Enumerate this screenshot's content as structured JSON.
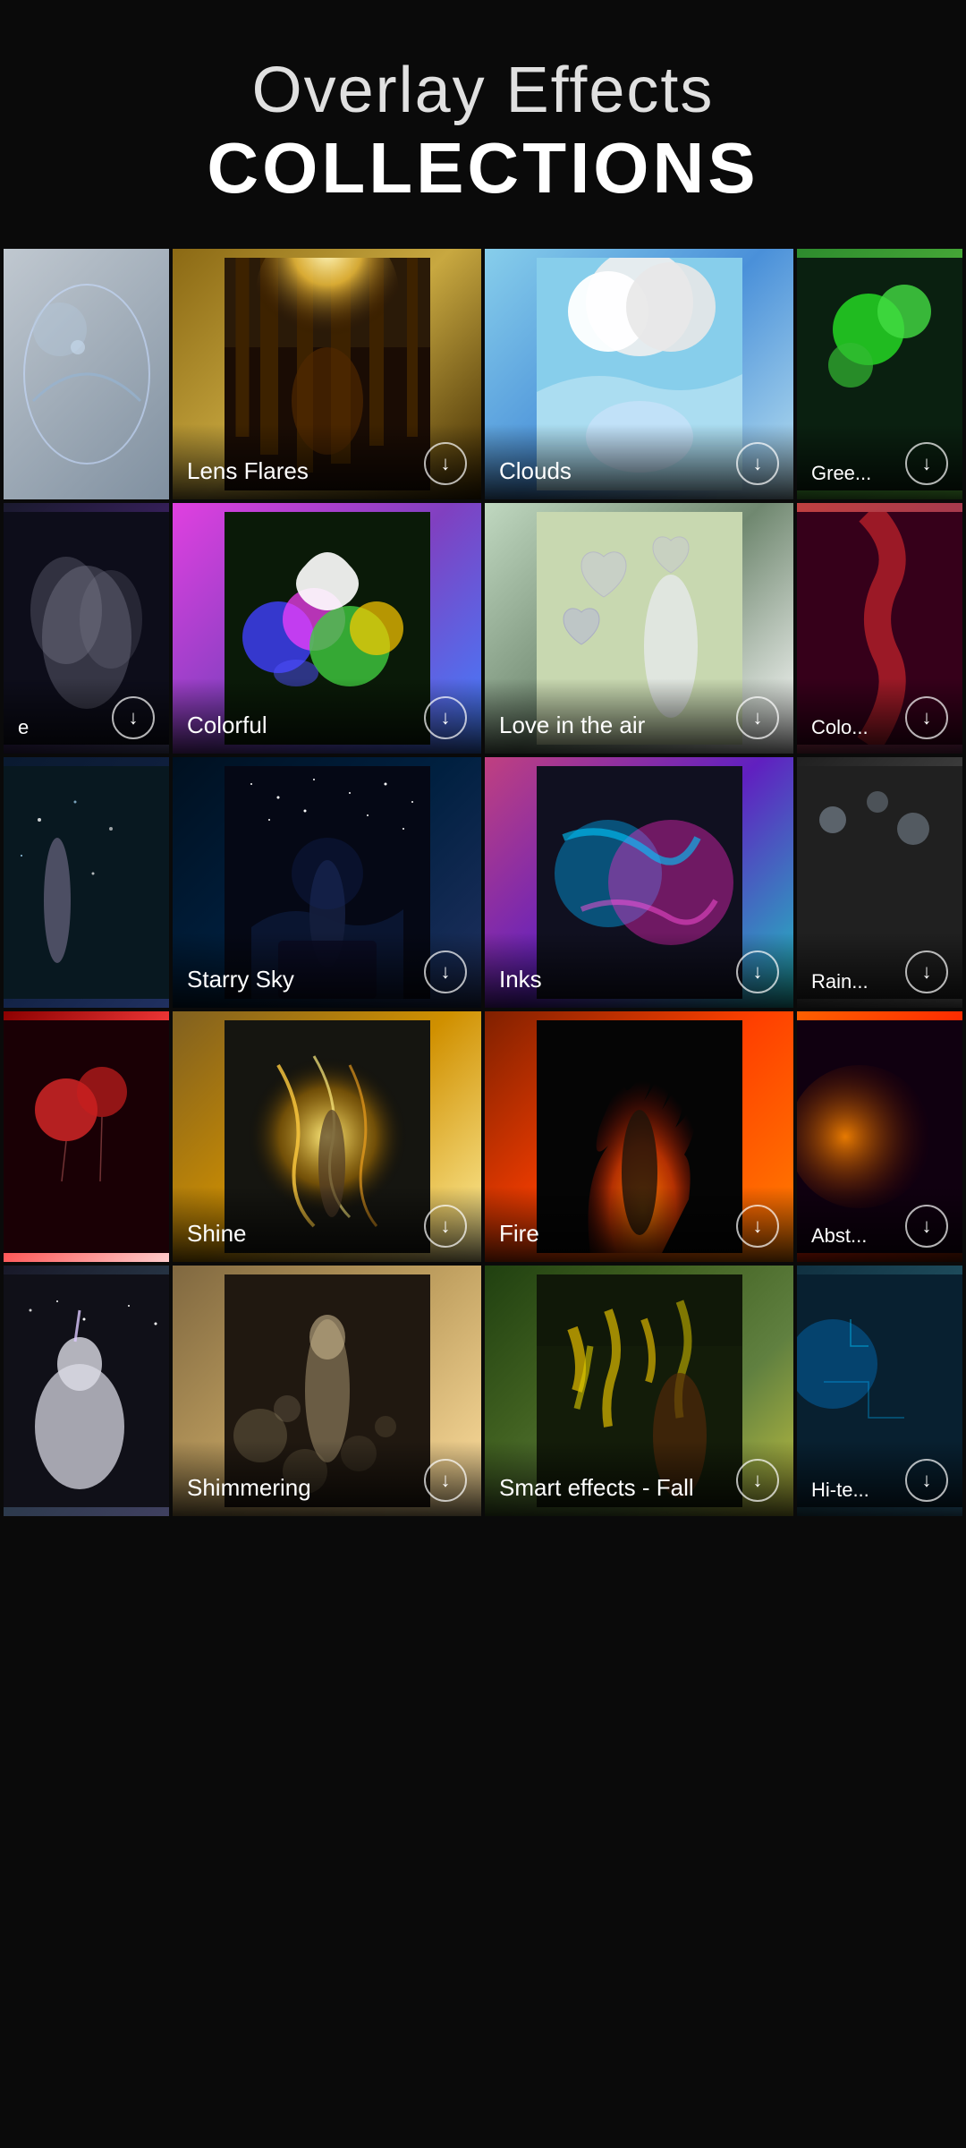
{
  "header": {
    "title_line1": "Overlay Effects",
    "title_line2": "COLLECTIONS"
  },
  "grid": {
    "rows": [
      {
        "id": "row1",
        "cards": [
          {
            "id": "card-water-horse",
            "label": "",
            "bg": "card-bg-1",
            "partial": true
          },
          {
            "id": "card-lens-flares",
            "label": "Lens Flares",
            "bg": "card-bg-2",
            "partial": false
          },
          {
            "id": "card-clouds",
            "label": "Clouds",
            "bg": "card-bg-3",
            "partial": false
          },
          {
            "id": "card-green",
            "label": "Gree...",
            "bg": "card-bg-4",
            "partial": true
          }
        ]
      },
      {
        "id": "row2",
        "cards": [
          {
            "id": "card-smoke",
            "label": "e",
            "bg": "card-bg-5",
            "partial": true
          },
          {
            "id": "card-colorful",
            "label": "Colorful",
            "bg": "card-bg-6",
            "partial": false
          },
          {
            "id": "card-love-air",
            "label": "Love in the air",
            "bg": "card-bg-7",
            "partial": false
          },
          {
            "id": "card-color2",
            "label": "Colo...",
            "bg": "card-bg-8",
            "partial": true
          }
        ]
      },
      {
        "id": "row3",
        "cards": [
          {
            "id": "card-fairy",
            "label": "",
            "bg": "card-bg-9",
            "partial": true
          },
          {
            "id": "card-starry-sky",
            "label": "Starry Sky",
            "bg": "card-bg-10",
            "partial": false
          },
          {
            "id": "card-inks",
            "label": "Inks",
            "bg": "card-bg-11",
            "partial": false
          },
          {
            "id": "card-rain",
            "label": "Rain...",
            "bg": "card-bg-12",
            "partial": true
          }
        ]
      },
      {
        "id": "row4",
        "cards": [
          {
            "id": "card-balloons",
            "label": "",
            "bg": "card-bg-13",
            "partial": true
          },
          {
            "id": "card-shine",
            "label": "Shine",
            "bg": "card-bg-14",
            "partial": false
          },
          {
            "id": "card-fire",
            "label": "Fire",
            "bg": "card-bg-15",
            "partial": false
          },
          {
            "id": "card-abstract",
            "label": "Abst...",
            "bg": "card-bg-16",
            "partial": true
          }
        ]
      },
      {
        "id": "row5",
        "cards": [
          {
            "id": "card-unicorn",
            "label": "",
            "bg": "card-bg-17",
            "partial": true
          },
          {
            "id": "card-shimmering",
            "label": "Shimmering",
            "bg": "card-bg-18",
            "partial": false
          },
          {
            "id": "card-smart-fall",
            "label": "Smart effects - Fall",
            "bg": "card-bg-19",
            "partial": false
          },
          {
            "id": "card-hitech",
            "label": "Hi-te...",
            "bg": "card-bg-20",
            "partial": true
          }
        ]
      }
    ]
  },
  "download_icon": "↓"
}
